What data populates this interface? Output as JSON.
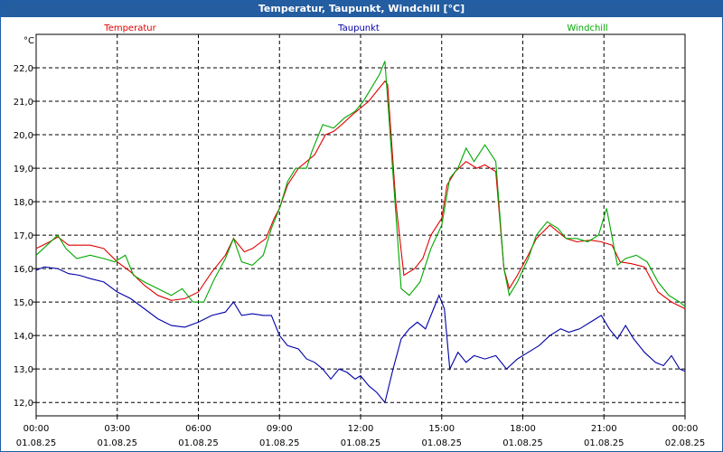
{
  "window": {
    "title": "Temperatur, Taupunkt, Windchill [°C]"
  },
  "chart_data": {
    "type": "line",
    "title": "Temperatur, Taupunkt, Windchill [°C]",
    "ylabel": "°C",
    "xlabel": "",
    "ylim": [
      11.6,
      23.0
    ],
    "xlim": [
      0,
      24
    ],
    "grid": true,
    "legend_position": "top",
    "y_ticks": [
      "12,0",
      "13,0",
      "14,0",
      "15,0",
      "16,0",
      "17,0",
      "18,0",
      "19,0",
      "20,0",
      "21,0",
      "22,0"
    ],
    "y_tick_values": [
      12,
      13,
      14,
      15,
      16,
      17,
      18,
      19,
      20,
      21,
      22
    ],
    "x_ticks": [
      {
        "time": "00:00",
        "date": "01.08.25",
        "hour": 0
      },
      {
        "time": "03:00",
        "date": "01.08.25",
        "hour": 3
      },
      {
        "time": "06:00",
        "date": "01.08.25",
        "hour": 6
      },
      {
        "time": "09:00",
        "date": "01.08.25",
        "hour": 9
      },
      {
        "time": "12:00",
        "date": "01.08.25",
        "hour": 12
      },
      {
        "time": "15:00",
        "date": "01.08.25",
        "hour": 15
      },
      {
        "time": "18:00",
        "date": "01.08.25",
        "hour": 18
      },
      {
        "time": "21:00",
        "date": "01.08.25",
        "hour": 21
      },
      {
        "time": "00:00",
        "date": "02.08.25",
        "hour": 24
      }
    ],
    "series": [
      {
        "name": "Temperatur",
        "color": "#e00000",
        "points": [
          [
            0,
            16.6
          ],
          [
            0.5,
            16.8
          ],
          [
            0.8,
            16.95
          ],
          [
            1.2,
            16.7
          ],
          [
            2,
            16.7
          ],
          [
            2.5,
            16.6
          ],
          [
            3,
            16.2
          ],
          [
            3.5,
            15.9
          ],
          [
            4,
            15.5
          ],
          [
            4.5,
            15.2
          ],
          [
            5,
            15.05
          ],
          [
            5.5,
            15.1
          ],
          [
            6,
            15.3
          ],
          [
            6.5,
            15.9
          ],
          [
            7,
            16.4
          ],
          [
            7.3,
            16.9
          ],
          [
            7.7,
            16.5
          ],
          [
            8,
            16.6
          ],
          [
            8.5,
            16.9
          ],
          [
            8.8,
            17.5
          ],
          [
            9,
            17.8
          ],
          [
            9.3,
            18.5
          ],
          [
            9.7,
            19.0
          ],
          [
            10,
            19.2
          ],
          [
            10.3,
            19.4
          ],
          [
            10.7,
            20.0
          ],
          [
            11,
            20.1
          ],
          [
            11.3,
            20.3
          ],
          [
            11.7,
            20.6
          ],
          [
            12,
            20.8
          ],
          [
            12.3,
            21.0
          ],
          [
            12.6,
            21.3
          ],
          [
            12.9,
            21.6
          ],
          [
            13.0,
            21.5
          ],
          [
            13.3,
            18.0
          ],
          [
            13.6,
            15.8
          ],
          [
            14,
            16.0
          ],
          [
            14.3,
            16.3
          ],
          [
            14.6,
            17.0
          ],
          [
            15,
            17.5
          ],
          [
            15.2,
            18.5
          ],
          [
            15.5,
            18.9
          ],
          [
            15.9,
            19.2
          ],
          [
            16.3,
            19.0
          ],
          [
            16.6,
            19.1
          ],
          [
            17,
            18.9
          ],
          [
            17.3,
            16.0
          ],
          [
            17.5,
            15.4
          ],
          [
            17.8,
            15.8
          ],
          [
            18.2,
            16.4
          ],
          [
            18.5,
            16.9
          ],
          [
            19,
            17.3
          ],
          [
            19.3,
            17.1
          ],
          [
            19.6,
            16.9
          ],
          [
            20,
            16.8
          ],
          [
            20.5,
            16.85
          ],
          [
            20.9,
            16.8
          ],
          [
            21.3,
            16.7
          ],
          [
            21.6,
            16.2
          ],
          [
            22,
            16.15
          ],
          [
            22.5,
            16.05
          ],
          [
            23,
            15.3
          ],
          [
            23.5,
            15.0
          ],
          [
            24,
            14.8
          ]
        ]
      },
      {
        "name": "Taupunkt",
        "color": "#0000a8",
        "points": [
          [
            0,
            15.95
          ],
          [
            0.3,
            16.05
          ],
          [
            0.8,
            16.0
          ],
          [
            1.2,
            15.85
          ],
          [
            1.6,
            15.8
          ],
          [
            2,
            15.7
          ],
          [
            2.5,
            15.6
          ],
          [
            3,
            15.3
          ],
          [
            3.5,
            15.1
          ],
          [
            4,
            14.8
          ],
          [
            4.5,
            14.5
          ],
          [
            5,
            14.3
          ],
          [
            5.5,
            14.25
          ],
          [
            6,
            14.4
          ],
          [
            6.5,
            14.6
          ],
          [
            7,
            14.7
          ],
          [
            7.3,
            15.0
          ],
          [
            7.6,
            14.6
          ],
          [
            8,
            14.65
          ],
          [
            8.4,
            14.6
          ],
          [
            8.7,
            14.6
          ],
          [
            9,
            14.0
          ],
          [
            9.3,
            13.7
          ],
          [
            9.7,
            13.6
          ],
          [
            10,
            13.3
          ],
          [
            10.3,
            13.2
          ],
          [
            10.6,
            13.0
          ],
          [
            10.9,
            12.7
          ],
          [
            11.2,
            13.0
          ],
          [
            11.5,
            12.9
          ],
          [
            11.8,
            12.7
          ],
          [
            12,
            12.8
          ],
          [
            12.3,
            12.5
          ],
          [
            12.6,
            12.3
          ],
          [
            12.9,
            12.0
          ],
          [
            13.2,
            13.0
          ],
          [
            13.5,
            13.9
          ],
          [
            13.8,
            14.2
          ],
          [
            14.1,
            14.4
          ],
          [
            14.4,
            14.2
          ],
          [
            14.7,
            14.8
          ],
          [
            14.9,
            15.2
          ],
          [
            15.1,
            14.8
          ],
          [
            15.3,
            13.0
          ],
          [
            15.6,
            13.5
          ],
          [
            15.9,
            13.2
          ],
          [
            16.2,
            13.4
          ],
          [
            16.6,
            13.3
          ],
          [
            17,
            13.4
          ],
          [
            17.4,
            13.0
          ],
          [
            17.8,
            13.3
          ],
          [
            18.2,
            13.5
          ],
          [
            18.6,
            13.7
          ],
          [
            19,
            14.0
          ],
          [
            19.4,
            14.2
          ],
          [
            19.7,
            14.1
          ],
          [
            20.1,
            14.2
          ],
          [
            20.5,
            14.4
          ],
          [
            20.9,
            14.6
          ],
          [
            21.2,
            14.2
          ],
          [
            21.5,
            13.9
          ],
          [
            21.8,
            14.3
          ],
          [
            22.1,
            13.9
          ],
          [
            22.5,
            13.5
          ],
          [
            22.9,
            13.2
          ],
          [
            23.2,
            13.1
          ],
          [
            23.5,
            13.4
          ],
          [
            23.8,
            13.0
          ],
          [
            24.1,
            12.9
          ],
          [
            24.5,
            12.7
          ],
          [
            24.9,
            12.5
          ]
        ]
      },
      {
        "name": "Windchill",
        "color": "#00a800",
        "points": [
          [
            0,
            16.4
          ],
          [
            0.4,
            16.7
          ],
          [
            0.8,
            17.0
          ],
          [
            1.1,
            16.6
          ],
          [
            1.5,
            16.3
          ],
          [
            2,
            16.4
          ],
          [
            2.5,
            16.3
          ],
          [
            2.9,
            16.2
          ],
          [
            3.3,
            16.4
          ],
          [
            3.6,
            15.8
          ],
          [
            4,
            15.6
          ],
          [
            4.5,
            15.4
          ],
          [
            5,
            15.2
          ],
          [
            5.4,
            15.4
          ],
          [
            5.8,
            15.0
          ],
          [
            6.2,
            15.0
          ],
          [
            6.6,
            15.7
          ],
          [
            7,
            16.3
          ],
          [
            7.3,
            16.9
          ],
          [
            7.6,
            16.2
          ],
          [
            8,
            16.1
          ],
          [
            8.4,
            16.4
          ],
          [
            8.7,
            17.2
          ],
          [
            9,
            17.8
          ],
          [
            9.3,
            18.6
          ],
          [
            9.6,
            19.0
          ],
          [
            10,
            19.0
          ],
          [
            10.2,
            19.5
          ],
          [
            10.6,
            20.3
          ],
          [
            11,
            20.2
          ],
          [
            11.4,
            20.5
          ],
          [
            11.8,
            20.7
          ],
          [
            12.1,
            21.0
          ],
          [
            12.4,
            21.4
          ],
          [
            12.7,
            21.8
          ],
          [
            12.9,
            22.2
          ],
          [
            13.2,
            18.8
          ],
          [
            13.5,
            15.4
          ],
          [
            13.8,
            15.2
          ],
          [
            14.2,
            15.6
          ],
          [
            14.6,
            16.6
          ],
          [
            15,
            17.3
          ],
          [
            15.3,
            18.7
          ],
          [
            15.6,
            19.0
          ],
          [
            15.9,
            19.6
          ],
          [
            16.2,
            19.2
          ],
          [
            16.6,
            19.7
          ],
          [
            17,
            19.2
          ],
          [
            17.3,
            16.0
          ],
          [
            17.5,
            15.2
          ],
          [
            17.8,
            15.6
          ],
          [
            18.2,
            16.3
          ],
          [
            18.5,
            17.0
          ],
          [
            18.9,
            17.4
          ],
          [
            19.3,
            17.2
          ],
          [
            19.6,
            16.9
          ],
          [
            20,
            16.9
          ],
          [
            20.4,
            16.8
          ],
          [
            20.8,
            17.0
          ],
          [
            21.1,
            17.8
          ],
          [
            21.5,
            16.1
          ],
          [
            21.8,
            16.3
          ],
          [
            22.2,
            16.4
          ],
          [
            22.6,
            16.2
          ],
          [
            23,
            15.6
          ],
          [
            23.4,
            15.2
          ],
          [
            23.8,
            15.0
          ],
          [
            24.1,
            14.8
          ],
          [
            24.5,
            14.6
          ],
          [
            24.9,
            14.4
          ]
        ]
      }
    ]
  }
}
